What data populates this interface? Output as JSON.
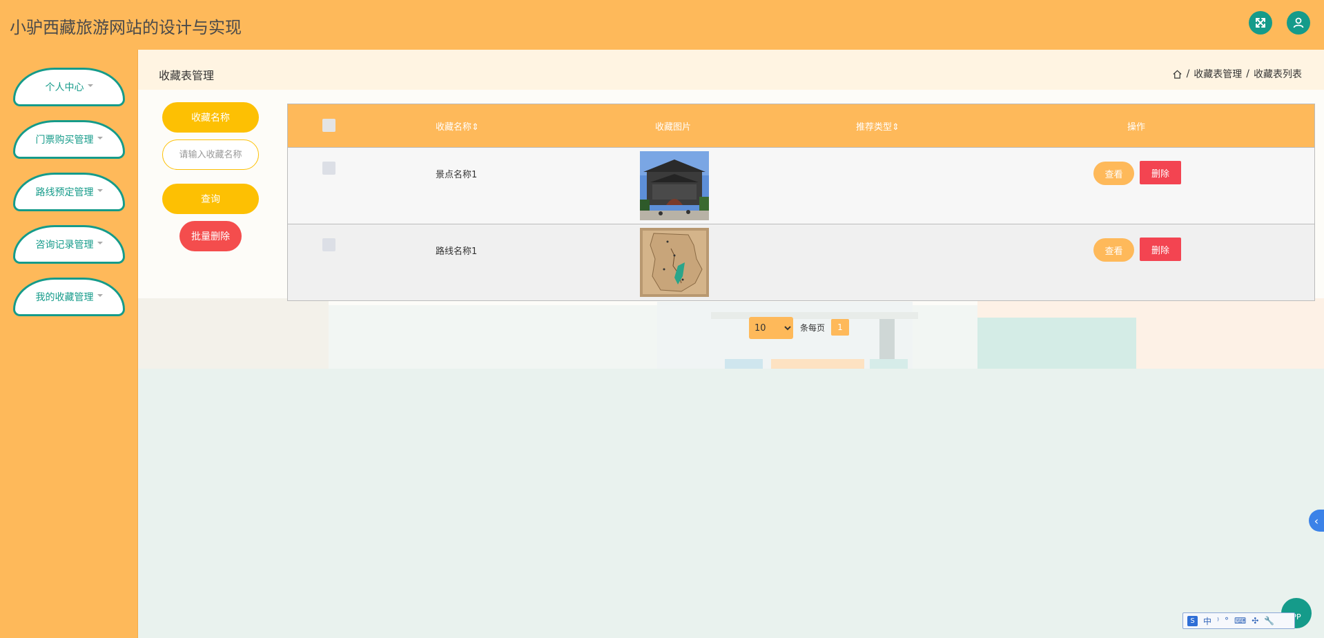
{
  "header": {
    "app_title": "小驴西藏旅游网站的设计与实现",
    "fullscreen_icon": "expand-arrows-icon",
    "user_icon": "user-icon"
  },
  "sidebar": {
    "items": [
      {
        "label": "个人中心"
      },
      {
        "label": "门票购买管理"
      },
      {
        "label": "路线预定管理"
      },
      {
        "label": "咨询记录管理"
      },
      {
        "label": "我的收藏管理"
      }
    ]
  },
  "page": {
    "title": "收藏表管理",
    "breadcrumb": [
      "收藏表管理",
      "收藏表列表"
    ],
    "breadcrumb_separator": "/"
  },
  "search": {
    "label": "收藏名称",
    "placeholder": "请输入收藏名称",
    "query_label": "查询",
    "bulk_delete_label": "批量删除"
  },
  "table": {
    "columns": [
      "收藏名称",
      "收藏图片",
      "推荐类型",
      "操作"
    ],
    "sort_glyph": "⇕",
    "rows": [
      {
        "name": "景点名称1",
        "image": "building-photo",
        "recommend_type": "",
        "view_label": "查看",
        "delete_label": "删除"
      },
      {
        "name": "路线名称1",
        "image": "map-photo",
        "recommend_type": "",
        "view_label": "查看",
        "delete_label": "删除"
      }
    ]
  },
  "pagination": {
    "page_size": "10",
    "page_size_options": [
      "10"
    ],
    "per_page_label": "条每页",
    "current_page": "1"
  },
  "floating": {
    "side_toggle": "‹",
    "app_badge": "PP",
    "ime_chars": [
      "中",
      "⁾",
      "°",
      "⌨",
      "✣",
      "🔧"
    ]
  },
  "colors": {
    "primary": "#feb95a",
    "accent": "#159b8a",
    "yellow": "#fdc003",
    "danger": "#f34451"
  }
}
